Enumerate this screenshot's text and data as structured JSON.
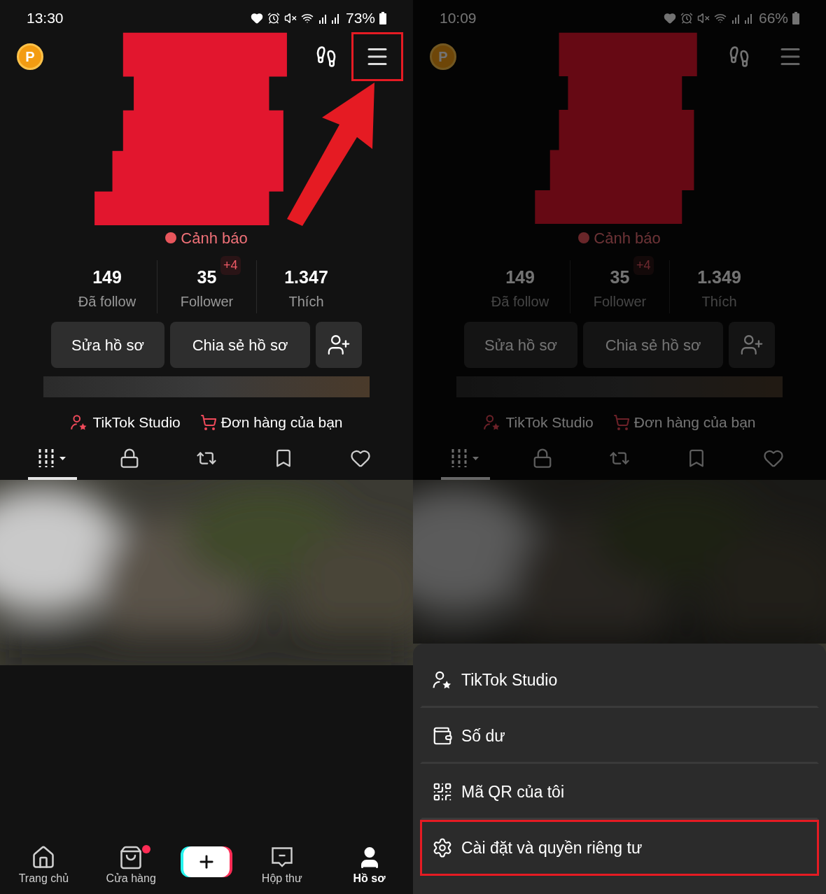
{
  "panels": [
    {
      "status_bar": {
        "time": "13:30",
        "battery": "73%"
      },
      "coin": "P",
      "dimmed": false,
      "menu_highlighted": true,
      "arrow": true,
      "warning": "Cảnh báo",
      "stats": [
        {
          "value": "149",
          "label": "Đã follow"
        },
        {
          "value": "35",
          "label": "Follower",
          "badge": "+4"
        },
        {
          "value": "1.347",
          "label": "Thích"
        }
      ],
      "buttons": [
        "Sửa hồ sơ",
        "Chia sẻ hồ sơ"
      ],
      "links": [
        {
          "kind": "studio",
          "label": "TikTok Studio"
        },
        {
          "kind": "orders",
          "label": "Đơn hàng của bạn"
        }
      ],
      "tabs": [
        {
          "kind": "videos",
          "selected": true
        },
        {
          "kind": "private",
          "selected": false
        },
        {
          "kind": "reposts",
          "selected": false
        },
        {
          "kind": "favorites",
          "selected": false
        },
        {
          "kind": "liked",
          "selected": false
        }
      ],
      "bottom_nav": [
        {
          "kind": "home",
          "label": "Trang chủ",
          "selected": false,
          "badge": false
        },
        {
          "kind": "shop",
          "label": "Cửa hàng",
          "selected": false,
          "badge": true
        },
        {
          "kind": "create",
          "selected": false
        },
        {
          "kind": "inbox",
          "label": "Hộp thư",
          "selected": false,
          "badge": false
        },
        {
          "kind": "profile",
          "label": "Hồ sơ",
          "selected": true,
          "badge": false
        }
      ]
    },
    {
      "status_bar": {
        "time": "10:09",
        "battery": "66%"
      },
      "coin": "P",
      "dimmed": true,
      "menu_highlighted": false,
      "arrow": false,
      "warning": "Cảnh báo",
      "stats": [
        {
          "value": "149",
          "label": "Đã follow"
        },
        {
          "value": "35",
          "label": "Follower",
          "badge": "+4"
        },
        {
          "value": "1.349",
          "label": "Thích"
        }
      ],
      "buttons": [
        "Sửa hồ sơ",
        "Chia sẻ hồ sơ"
      ],
      "links": [
        {
          "kind": "studio",
          "label": "TikTok Studio"
        },
        {
          "kind": "orders",
          "label": "Đơn hàng của bạn"
        }
      ],
      "tabs": [
        {
          "kind": "videos",
          "selected": true
        },
        {
          "kind": "private",
          "selected": false
        },
        {
          "kind": "reposts",
          "selected": false
        },
        {
          "kind": "favorites",
          "selected": false
        },
        {
          "kind": "liked",
          "selected": false
        }
      ],
      "menu": {
        "items": [
          {
            "kind": "studio",
            "label": "TikTok Studio",
            "highlighted": false
          },
          {
            "kind": "wallet",
            "label": "Số dư",
            "highlighted": false
          },
          {
            "kind": "qr",
            "label": "Mã QR của tôi",
            "highlighted": false
          },
          {
            "kind": "settings",
            "label": "Cài đặt và quyền riêng tư",
            "highlighted": true
          }
        ]
      }
    }
  ]
}
